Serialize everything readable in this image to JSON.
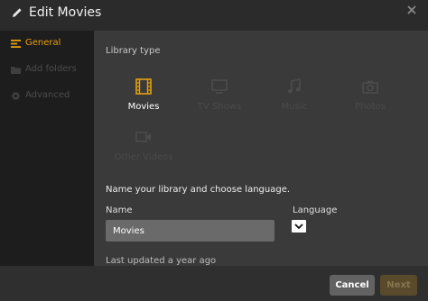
{
  "header": {
    "title": "Edit Movies",
    "edit_icon": "pencil-icon",
    "close_icon": "close-icon"
  },
  "sidebar": {
    "items": [
      {
        "label": "General",
        "icon": "general-icon",
        "active": true
      },
      {
        "label": "Add folders",
        "icon": "folder-icon",
        "active": false
      },
      {
        "label": "Advanced",
        "icon": "gear-icon",
        "active": false
      }
    ]
  },
  "main": {
    "library_type_label": "Library type",
    "types": [
      {
        "label": "Movies",
        "icon": "film-icon",
        "selected": true
      },
      {
        "label": "TV Shows",
        "icon": "tv-icon",
        "selected": false
      },
      {
        "label": "Music",
        "icon": "music-icon",
        "selected": false
      },
      {
        "label": "Photos",
        "icon": "camera-icon",
        "selected": false
      },
      {
        "label": "Other Videos",
        "icon": "video-camera-icon",
        "selected": false
      }
    ],
    "prompt": "Name your library and choose language.",
    "name_label": "Name",
    "name_value": "Movies",
    "language_label": "Language",
    "last_updated": "Last updated a year ago"
  },
  "footer": {
    "cancel_label": "Cancel",
    "next_label": "Next"
  },
  "colors": {
    "accent": "#e5a00d",
    "panel": "#3a3a3a",
    "sidebar": "#1d1d1d"
  }
}
